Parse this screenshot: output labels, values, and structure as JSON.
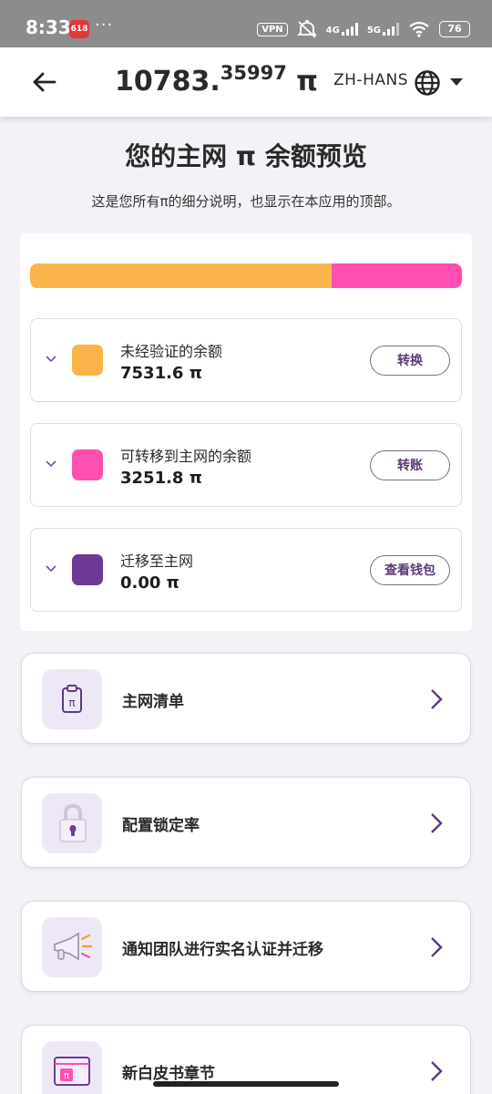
{
  "status_bar": {
    "time": "8:33",
    "app_badge": "618",
    "more": "···",
    "vpn": "VPN",
    "net1": "4G",
    "net2": "5G",
    "battery": "76"
  },
  "header": {
    "balance_whole": "10783.",
    "balance_frac": "35997",
    "balance_unit": "π",
    "language": "ZH-HANS"
  },
  "page": {
    "title": "您的主网 π 余额预览",
    "subtitle": "这是您所有π的细分说明，也显示在本应用的顶部。"
  },
  "balance_bar": {
    "segments": [
      {
        "fraction": 0.698,
        "color": "#fbb44a"
      },
      {
        "fraction": 0.302,
        "color": "#ff4fb0"
      }
    ]
  },
  "balances": [
    {
      "label": "未经验证的余额",
      "value": "7531.6 π",
      "button": "转换",
      "color": "#fbb44a"
    },
    {
      "label": "可转移到主网的余额",
      "value": "3251.8 π",
      "button": "转账",
      "color": "#ff4fb0"
    },
    {
      "label": "迁移至主网",
      "value": "0.00 π",
      "button": "查看钱包",
      "color": "#6e3a97"
    }
  ],
  "features": [
    {
      "label": "主网清单",
      "icon": "clipboard-pi-icon"
    },
    {
      "label": "配置锁定率",
      "icon": "padlock-icon"
    },
    {
      "label": "通知团队进行实名认证并迁移",
      "icon": "megaphone-icon"
    },
    {
      "label": "新白皮书章节",
      "icon": "whitepaper-icon"
    }
  ]
}
